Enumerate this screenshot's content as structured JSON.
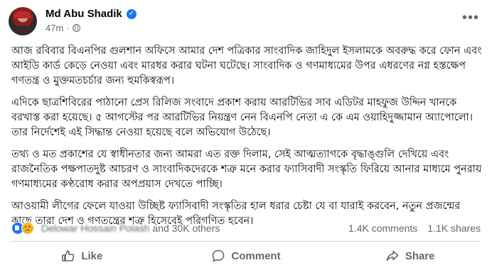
{
  "post": {
    "author": {
      "name": "Md Abu Shadik",
      "timestamp": "47m"
    },
    "paragraphs": [
      "আজ রবিবার বিএনপির গুলশান অফিসে আমার দেশ পত্রিকার সাংবাদিক জাহিদুল ইসলামকে অবরুদ্ধ করে ফোন এবং আইডি কার্ড কেড়ে নেওয়া এবং মারধর করার ঘটনা ঘটেছে। সাংবাদিক ও গণমাধ্যমের উপর এধরণের নগ্ন হস্তক্ষেপ গণতন্ত্র ও মুক্তমতচর্চার জন্য হুমকিস্বরূপ।",
      "এদিকে ছাত্রশিবিরের পাঠানো প্রেস রিলিজ সংবাদে প্রকাশ করায় আরটিভির সাব এডিটর মাহফুজ উদ্দিন খানকে বরখাস্ত করা হয়েছে। ৫ আগস্টের পর আরটিভির নিয়ন্ত্রণ নেন বিএনপি নেতা এ কে এম ওয়াহিদুজ্জামান অ্যাপোলো। তার নির্দেশেই এই সিদ্ধান্ত নেওয়া হয়েছে বলে অভিযোগ উঠেছে।",
      "তথ্য ও মত প্রকাশের যে স্বাধীনতার জন্য আমরা এত রক্ত দিলাম, সেই আত্মত্যাগকে বৃদ্ধাঙ্গুলি দেখিয়ে এবং রাজনৈতিক পক্ষপাতদুষ্ট আচরণ ও সাংবাদিকদেরকে শত্রু মনে করার ফ্যাসিবাদী সংস্কৃতি ফিরিয়ে আনার মাধ্যমে পুনরায় গণমাধ্যমের কণ্ঠরোধ করার অপপ্রয়াস দেখতে পাচ্ছি।",
      "আওয়ামী লীগের ফেলে যাওয়া উচ্ছিষ্ট ফ্যাসিবাদী সংস্কৃতির হাল ধরার চেষ্টা যে বা যারাই করবেন, নতুন প্রজন্মের কাছে তারা দেশ ও গণতন্ত্রের শত্রু হিসেবেই পরিগণিত হবেন।"
    ],
    "reactions": {
      "names_blurred": "Delowar Hossain Polash",
      "names_suffix": "and 30K others",
      "comments": "1.4K comments",
      "shares": "1.1K shares",
      "icons": [
        "like-icon",
        "sad-icon"
      ],
      "like_color": "#1877f2",
      "sad_color": "#f7b125"
    },
    "actions": {
      "like": "Like",
      "comment": "Comment",
      "share": "Share"
    }
  },
  "colors": {
    "text": "#050505",
    "secondary": "#65676b",
    "verified": "#1877f2",
    "divider": "#ced0d4"
  }
}
